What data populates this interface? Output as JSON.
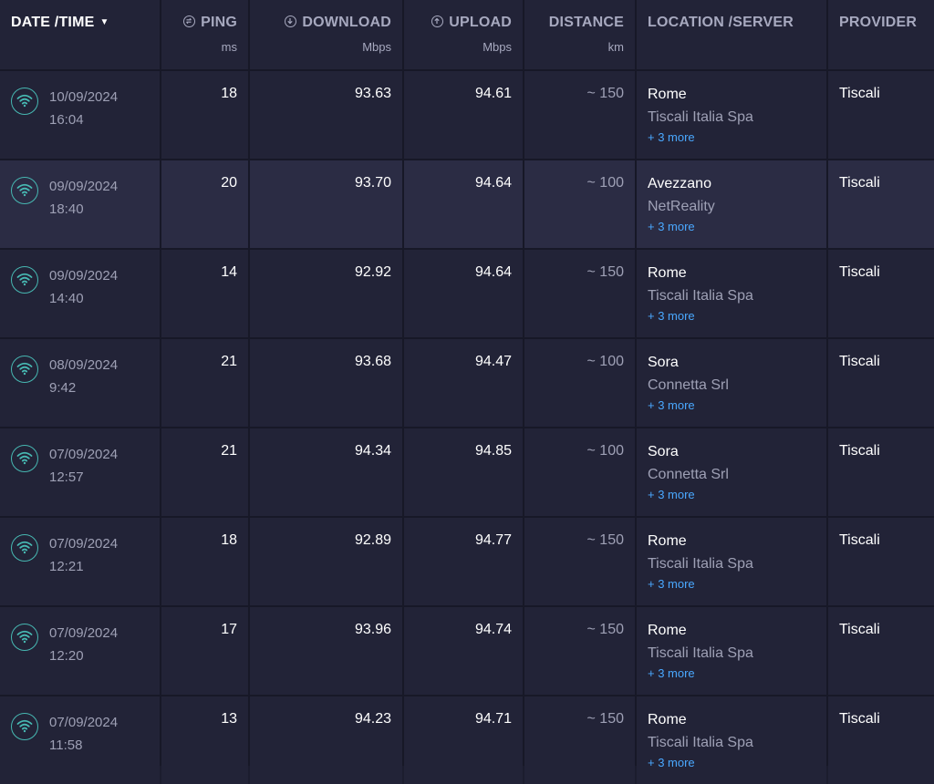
{
  "headers": {
    "datetime": "DATE /TIME",
    "ping": "PING",
    "ping_unit": "ms",
    "download": "DOWNLOAD",
    "download_unit": "Mbps",
    "upload": "UPLOAD",
    "upload_unit": "Mbps",
    "distance": "DISTANCE",
    "distance_unit": "km",
    "location": "LOCATION /SERVER",
    "provider": "PROVIDER"
  },
  "colors": {
    "background": "#222337",
    "highlight_row": "#2b2c44",
    "wifi_icon": "#47b8b2",
    "link": "#4aa8ff",
    "muted_text": "#9ea0b5"
  },
  "icons": {
    "sort": "caret-down-icon",
    "ping": "ping-icon",
    "download": "download-icon",
    "upload": "upload-icon",
    "connection": "wifi-icon"
  },
  "rows": [
    {
      "date": "10/09/2024",
      "time": "16:04",
      "ping": "18",
      "download": "93.63",
      "upload": "94.61",
      "distance": "~ 150",
      "city": "Rome",
      "server": "Tiscali Italia Spa",
      "more": "+ 3 more",
      "provider": "Tiscali"
    },
    {
      "date": "09/09/2024",
      "time": "18:40",
      "ping": "20",
      "download": "93.70",
      "upload": "94.64",
      "distance": "~ 100",
      "city": "Avezzano",
      "server": "NetReality",
      "more": "+ 3 more",
      "provider": "Tiscali"
    },
    {
      "date": "09/09/2024",
      "time": "14:40",
      "ping": "14",
      "download": "92.92",
      "upload": "94.64",
      "distance": "~ 150",
      "city": "Rome",
      "server": "Tiscali Italia Spa",
      "more": "+ 3 more",
      "provider": "Tiscali"
    },
    {
      "date": "08/09/2024",
      "time": "9:42",
      "ping": "21",
      "download": "93.68",
      "upload": "94.47",
      "distance": "~ 100",
      "city": "Sora",
      "server": "Connetta Srl",
      "more": "+ 3 more",
      "provider": "Tiscali"
    },
    {
      "date": "07/09/2024",
      "time": "12:57",
      "ping": "21",
      "download": "94.34",
      "upload": "94.85",
      "distance": "~ 100",
      "city": "Sora",
      "server": "Connetta Srl",
      "more": "+ 3 more",
      "provider": "Tiscali"
    },
    {
      "date": "07/09/2024",
      "time": "12:21",
      "ping": "18",
      "download": "92.89",
      "upload": "94.77",
      "distance": "~ 150",
      "city": "Rome",
      "server": "Tiscali Italia Spa",
      "more": "+ 3 more",
      "provider": "Tiscali"
    },
    {
      "date": "07/09/2024",
      "time": "12:20",
      "ping": "17",
      "download": "93.96",
      "upload": "94.74",
      "distance": "~ 150",
      "city": "Rome",
      "server": "Tiscali Italia Spa",
      "more": "+ 3 more",
      "provider": "Tiscali"
    },
    {
      "date": "07/09/2024",
      "time": "11:58",
      "ping": "13",
      "download": "94.23",
      "upload": "94.71",
      "distance": "~ 150",
      "city": "Rome",
      "server": "Tiscali Italia Spa",
      "more": "+ 3 more",
      "provider": "Tiscali"
    }
  ]
}
